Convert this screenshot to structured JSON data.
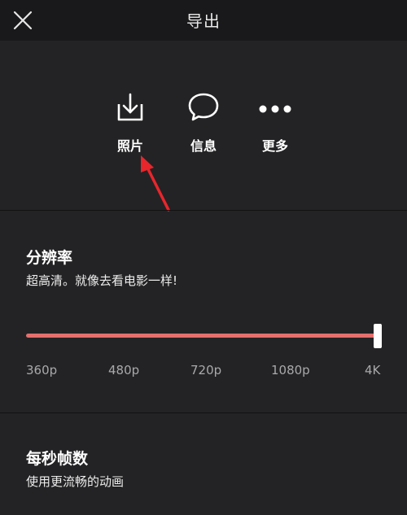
{
  "header": {
    "title": "导出",
    "close_icon": "close-icon"
  },
  "share": {
    "items": [
      {
        "label": "照片",
        "icon": "download-icon"
      },
      {
        "label": "信息",
        "icon": "chat-bubble-icon"
      },
      {
        "label": "更多",
        "icon": "more-dots-icon"
      }
    ],
    "annotation_color": "#e8262c"
  },
  "resolution": {
    "title": "分辨率",
    "subtitle": "超高清。就像去看电影一样!",
    "options": [
      "360p",
      "480p",
      "720p",
      "1080p",
      "4K"
    ],
    "selected": "4K",
    "slider_value": 1.0,
    "accent_color": "#e46f6e"
  },
  "frame_rate": {
    "title": "每秒帧数",
    "subtitle": "使用更流畅的动画"
  }
}
